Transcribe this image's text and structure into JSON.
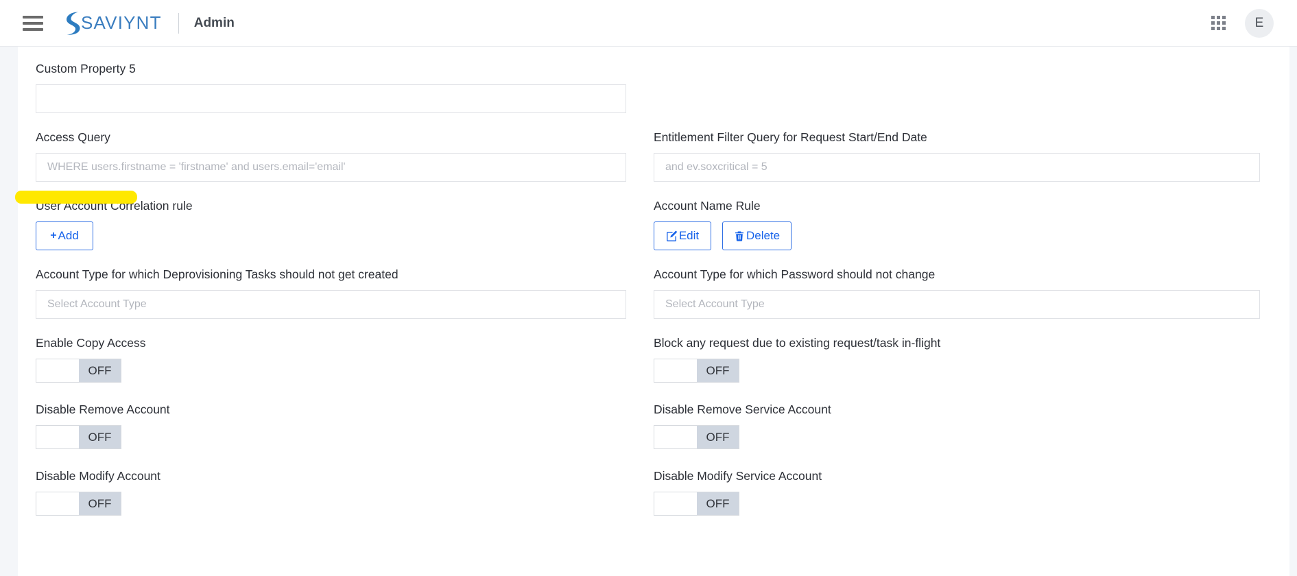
{
  "header": {
    "menu_icon": "hamburger-icon",
    "brand_name": "SAVIYNT",
    "section_title": "Admin",
    "apps_icon": "grid-apps-icon",
    "avatar_initial": "E"
  },
  "colors": {
    "brand_blue": "#3a7dbf",
    "action_blue": "#1763ea",
    "toggle_track": "#cfd6e0",
    "highlight_yellow": "#ffe800",
    "page_bg": "#f4f6f9"
  },
  "annotations": {
    "highlight_target": "Access Query"
  },
  "form": {
    "rows": [
      {
        "left": {
          "label": "Custom Property 5",
          "control": "text",
          "value": "",
          "placeholder": ""
        },
        "right": null
      },
      {
        "left": {
          "label": "Access Query",
          "control": "text",
          "value": "",
          "placeholder": "WHERE users.firstname = 'firstname' and users.email='email'"
        },
        "right": {
          "label": "Entitlement Filter Query for Request Start/End Date",
          "control": "text",
          "value": "",
          "placeholder": "and ev.soxcritical = 5"
        }
      },
      {
        "left": {
          "label": "User Account Correlation rule",
          "control": "buttons",
          "buttons": [
            {
              "label": "Add",
              "icon": "plus-icon"
            }
          ]
        },
        "right": {
          "label": "Account Name Rule",
          "control": "buttons",
          "buttons": [
            {
              "label": "Edit",
              "icon": "pencil-square-icon"
            },
            {
              "label": "Delete",
              "icon": "trash-icon"
            }
          ]
        }
      },
      {
        "left": {
          "label": "Account Type for which Deprovisioning Tasks should not get created",
          "control": "text",
          "value": "",
          "placeholder": "Select Account Type"
        },
        "right": {
          "label": "Account Type for which Password should not change",
          "control": "text",
          "value": "",
          "placeholder": "Select Account Type"
        }
      },
      {
        "left": {
          "label": "Enable Copy Access",
          "control": "toggle",
          "state": "OFF"
        },
        "right": {
          "label": "Block any request due to existing request/task in-flight",
          "control": "toggle",
          "state": "OFF"
        }
      },
      {
        "left": {
          "label": "Disable Remove Account",
          "control": "toggle",
          "state": "OFF"
        },
        "right": {
          "label": "Disable Remove Service Account",
          "control": "toggle",
          "state": "OFF"
        }
      },
      {
        "left": {
          "label": "Disable Modify Account",
          "control": "toggle",
          "state": "OFF"
        },
        "right": {
          "label": "Disable Modify Service Account",
          "control": "toggle",
          "state": "OFF"
        }
      }
    ]
  }
}
